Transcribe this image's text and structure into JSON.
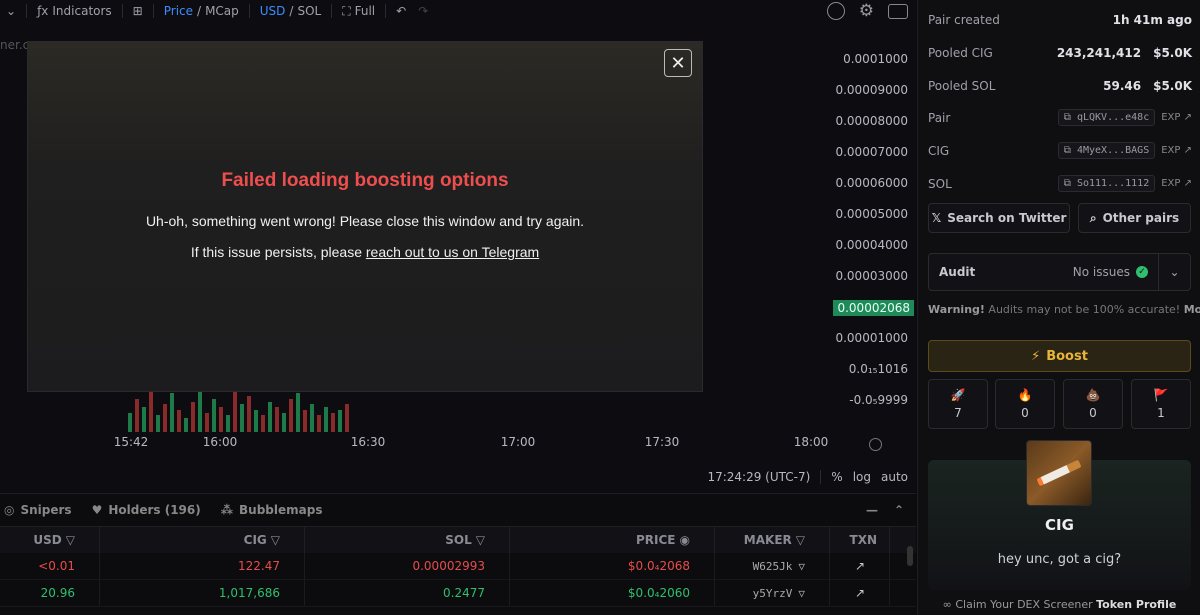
{
  "toolbar": {
    "indicators": "Indicators",
    "price": "Price",
    "mcap": "MCap",
    "usd": "USD",
    "sol": "SOL",
    "full": "Full",
    "slash": "/",
    "fx_glyph": "ƒx"
  },
  "chart": {
    "watermark": "ner.cc",
    "price_labels": [
      "0.0001000",
      "0.00009000",
      "0.00008000",
      "0.00007000",
      "0.00006000",
      "0.00005000",
      "0.00004000",
      "0.00003000",
      "0.00002068",
      "0.00001000",
      "0.0₁₅1016",
      "-0.0₅9999"
    ],
    "current_price": "0.00002068",
    "time_labels": [
      "15:42",
      "16:00",
      "16:30",
      "17:00",
      "17:30",
      "18:00"
    ],
    "clock": "17:24:29 (UTC-7)",
    "percent": "%",
    "log": "log",
    "auto": "auto",
    "volume_bars": [
      {
        "h": 0.35,
        "up": true
      },
      {
        "h": 0.6,
        "up": false
      },
      {
        "h": 0.45,
        "up": true
      },
      {
        "h": 0.8,
        "up": false
      },
      {
        "h": 0.3,
        "up": true
      },
      {
        "h": 0.5,
        "up": false
      },
      {
        "h": 0.7,
        "up": true
      },
      {
        "h": 0.4,
        "up": false
      },
      {
        "h": 0.25,
        "up": true
      },
      {
        "h": 0.55,
        "up": false
      },
      {
        "h": 0.9,
        "up": true
      },
      {
        "h": 0.35,
        "up": false
      },
      {
        "h": 0.6,
        "up": true
      },
      {
        "h": 0.45,
        "up": false
      },
      {
        "h": 0.3,
        "up": true
      },
      {
        "h": 0.75,
        "up": false
      },
      {
        "h": 0.5,
        "up": true
      },
      {
        "h": 0.65,
        "up": false
      },
      {
        "h": 0.4,
        "up": true
      },
      {
        "h": 0.3,
        "up": false
      },
      {
        "h": 0.55,
        "up": true
      },
      {
        "h": 0.45,
        "up": false
      },
      {
        "h": 0.35,
        "up": true
      },
      {
        "h": 0.6,
        "up": false
      },
      {
        "h": 0.7,
        "up": true
      },
      {
        "h": 0.4,
        "up": false
      },
      {
        "h": 0.5,
        "up": true
      },
      {
        "h": 0.3,
        "up": false
      },
      {
        "h": 0.45,
        "up": true
      },
      {
        "h": 0.35,
        "up": false
      },
      {
        "h": 0.4,
        "up": true
      },
      {
        "h": 0.5,
        "up": false
      }
    ]
  },
  "modal": {
    "title": "Failed loading boosting options",
    "message": "Uh-oh, something went wrong! Please close this window and try again.",
    "help_prefix": "If this issue persists, please ",
    "help_link": "reach out to us on Telegram",
    "close": "✕"
  },
  "tabs": {
    "snipers": "Snipers",
    "holders": "Holders (196)",
    "bubblemaps": "Bubblemaps"
  },
  "table": {
    "headers": [
      "USD",
      "CIG",
      "SOL",
      "PRICE",
      "MAKER",
      "TXN"
    ],
    "rows": [
      {
        "usd": "<0.01",
        "cig": "122.47",
        "sol": "0.00002993",
        "price": "$0.0₄2068",
        "maker": "W625Jk",
        "side": "sell"
      },
      {
        "usd": "20.96",
        "cig": "1,017,686",
        "sol": "0.2477",
        "price": "$0.0₄2060",
        "maker": "y5YrzV",
        "side": "buy"
      }
    ]
  },
  "sidebar": {
    "pair_created_label": "Pair created",
    "pair_created_value": "1h 41m ago",
    "pooled_cig_label": "Pooled CIG",
    "pooled_cig_amount": "243,241,412",
    "pooled_cig_usd": "$5.0K",
    "pooled_sol_label": "Pooled SOL",
    "pooled_sol_amount": "59.46",
    "pooled_sol_usd": "$5.0K",
    "pair_label": "Pair",
    "pair_addr": "qLQKV...e48c",
    "cig_label": "CIG",
    "cig_addr": "4MyeX...BAGS",
    "sol_label": "SOL",
    "sol_addr": "So111...1112",
    "exp": "EXP",
    "search_twitter": "Search on Twitter",
    "other_pairs": "Other pairs",
    "audit_label": "Audit",
    "audit_value": "No issues",
    "audit_warn_bold": "Warning!",
    "audit_warn_text": " Audits may not be 100% accurate! ",
    "audit_warn_more": "More.",
    "boost": "Boost",
    "reactions": [
      {
        "icon": "rocket-icon",
        "glyph": "🚀",
        "count": "7"
      },
      {
        "icon": "fire-icon",
        "glyph": "🔥",
        "count": "0"
      },
      {
        "icon": "poop-icon",
        "glyph": "💩",
        "count": "0"
      },
      {
        "icon": "flag-icon",
        "glyph": "🚩",
        "count": "1"
      }
    ],
    "token_name": "CIG",
    "token_desc": "hey unc, got a cig?",
    "claim_text": "Claim Your DEX Screener ",
    "claim_bold": "Token Profile"
  },
  "colors": {
    "accent": "#3b8cff",
    "error": "#ef4e4e",
    "buy": "#2fbf6f",
    "sell": "#e74c4c",
    "boost": "#e8b43a"
  }
}
